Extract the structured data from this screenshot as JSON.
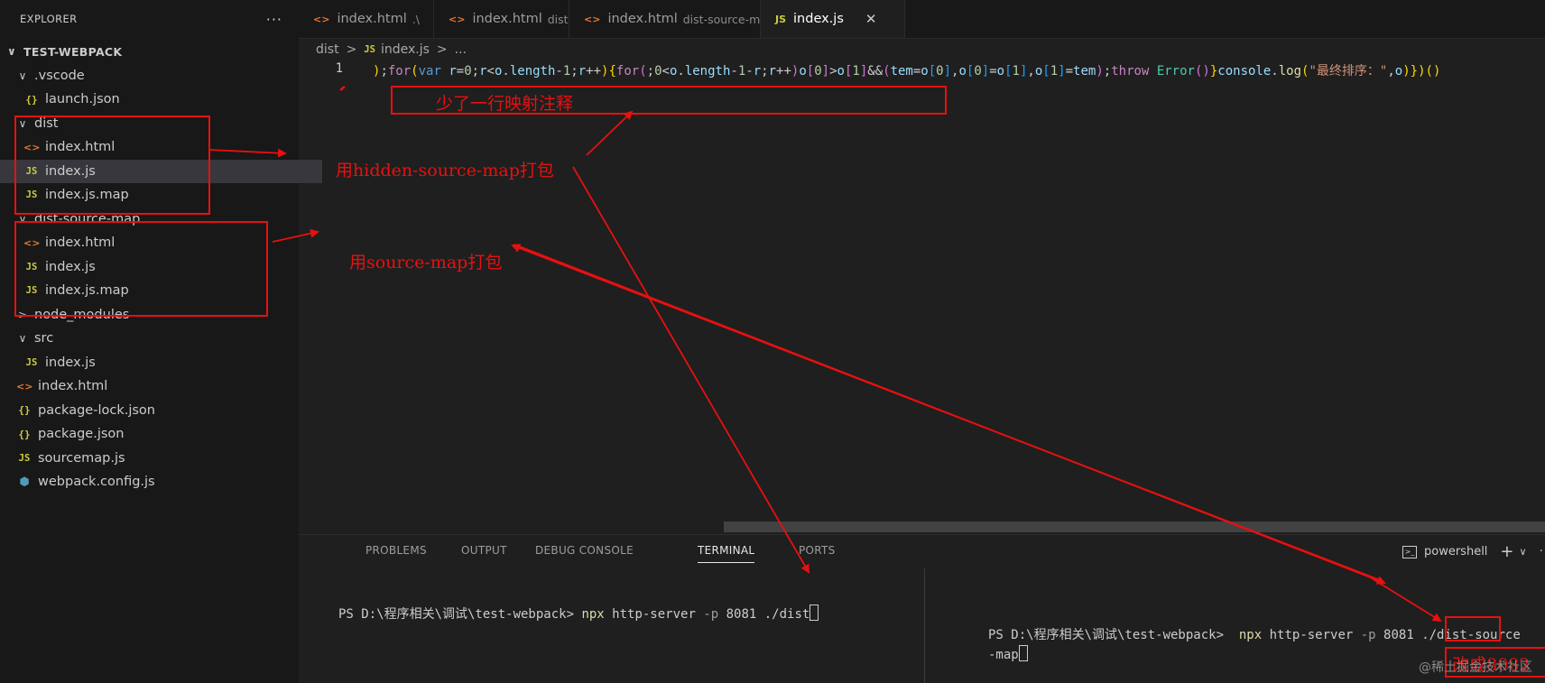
{
  "explorer": {
    "title": "EXPLORER",
    "more": "···",
    "items": [
      {
        "label": "TEST-WEBPACK",
        "kind": "root",
        "chev": "∨",
        "depth": 0
      },
      {
        "label": ".vscode",
        "kind": "folder",
        "chev": "∨",
        "depth": 1
      },
      {
        "label": "launch.json",
        "kind": "json",
        "icon": "{}",
        "depth": 2
      },
      {
        "label": "dist",
        "kind": "folder",
        "chev": "∨",
        "depth": 1
      },
      {
        "label": "index.html",
        "kind": "html",
        "icon": "<>",
        "depth": 2
      },
      {
        "label": "index.js",
        "kind": "js",
        "icon": "JS",
        "depth": 2,
        "selected": true
      },
      {
        "label": "index.js.map",
        "kind": "js",
        "icon": "JS",
        "depth": 2
      },
      {
        "label": "dist-source-map",
        "kind": "folder",
        "chev": "∨",
        "depth": 1
      },
      {
        "label": "index.html",
        "kind": "html",
        "icon": "<>",
        "depth": 2
      },
      {
        "label": "index.js",
        "kind": "js",
        "icon": "JS",
        "depth": 2
      },
      {
        "label": "index.js.map",
        "kind": "js",
        "icon": "JS",
        "depth": 2
      },
      {
        "label": "node_modules",
        "kind": "folder",
        "chev": ">",
        "depth": 1
      },
      {
        "label": "src",
        "kind": "folder",
        "chev": "∨",
        "depth": 1
      },
      {
        "label": "index.js",
        "kind": "js",
        "icon": "JS",
        "depth": 2
      },
      {
        "label": "index.html",
        "kind": "html",
        "icon": "<>",
        "depth": 1
      },
      {
        "label": "package-lock.json",
        "kind": "json",
        "icon": "{}",
        "depth": 1
      },
      {
        "label": "package.json",
        "kind": "json",
        "icon": "{}",
        "depth": 1
      },
      {
        "label": "sourcemap.js",
        "kind": "js",
        "icon": "JS",
        "depth": 1
      },
      {
        "label": "webpack.config.js",
        "kind": "wp",
        "icon": "⬢",
        "depth": 1
      }
    ]
  },
  "tabs": [
    {
      "label": "index.html",
      "desc": ".\\",
      "icon": "<>"
    },
    {
      "label": "index.html",
      "desc": "dist",
      "icon": "<>",
      "dirty": true
    },
    {
      "label": "index.html",
      "desc": "dist-source-map",
      "icon": "<>"
    },
    {
      "label": "index.js",
      "desc": "",
      "icon": "JS",
      "active": true,
      "close": "✕"
    }
  ],
  "breadcrumb": {
    "folder": "dist",
    "sep": ">",
    "icon": "JS",
    "file": "index.js",
    "rest": "..."
  },
  "editor": {
    "line_number": "1",
    "code_line": ");for(var r=0;r<o.length-1;r++){for(;0<o.length-1-r;r++)o[0]>o[1]&&(tem=o[0],o[0]=o[1],o[1]=tem);throw Error()}console.log(\"最终排序：\",o)})()"
  },
  "panel": {
    "tabs": [
      "PROBLEMS",
      "OUTPUT",
      "DEBUG CONSOLE",
      "TERMINAL",
      "PORTS"
    ],
    "active_tab": "TERMINAL",
    "shell": "powershell",
    "plus": "+",
    "chev": "∨",
    "more": "···"
  },
  "terminal_left": {
    "prompt": "PS D:\\程序相关\\调试\\test-webpack> ",
    "cmd": "npx",
    "args": " http-server ",
    "flag": "-p",
    "rest": " 8081 ./dist"
  },
  "terminal_right": {
    "prompt": "PS D:\\程序相关\\调试\\test-webpack>  ",
    "cmd": "npx",
    "args": " http-server ",
    "flag": "-p",
    "port": "8081",
    "rest": " ./dist-source",
    "line2": "-map"
  },
  "annotations": {
    "missing_comment": "少了一行映射注释",
    "hidden_pkg": "用hidden-source-map打包",
    "sm_pkg": "用source-map打包",
    "change_port": "改成8082"
  },
  "watermark": "@稀土掘金技术社区",
  "colors": {
    "annotation": "#e81010",
    "editor_bg": "#1f1f1f",
    "sidebar_bg": "#181818"
  }
}
